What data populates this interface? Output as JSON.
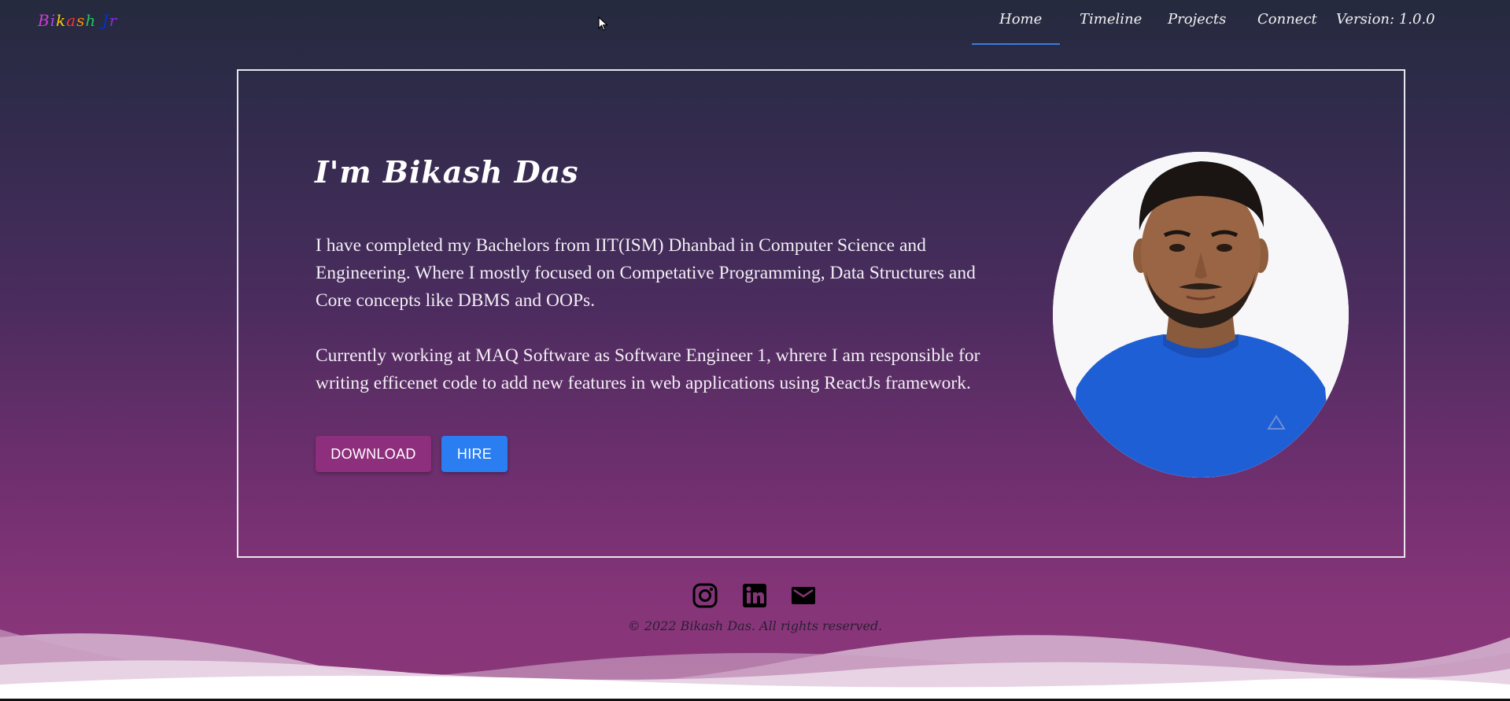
{
  "header": {
    "logo_text": "Bikash Jr",
    "logo_colors": [
      "#d23ad6",
      "#b040f0",
      "#ffcc00",
      "#ff3030",
      "#ff8a00",
      "#22c55e",
      "#1e90ff",
      "#0033cc",
      "#8a2be2"
    ],
    "nav": {
      "home": "Home",
      "timeline": "Timeline",
      "projects": "Projects",
      "connect": "Connect",
      "version": "Version: 1.0.0"
    },
    "active_color": "#3b7bd8"
  },
  "hero": {
    "title": "I'm Bikash Das",
    "paragraph_1": "I have completed my Bachelors from IIT(ISM) Dhanbad in Computer Science and Engineering. Where I mostly focused on Competative Programming, Data Structures and Core concepts like DBMS and OOPs.",
    "paragraph_2": "Currently working at MAQ Software as Software Engineer 1, whrere I am responsible for writing efficenet code to add new features in web applications using ReactJs framework.",
    "download_label": "DOWNLOAD",
    "hire_label": "HIRE",
    "download_color": "#8e2f7d",
    "hire_color": "#2a7ef2"
  },
  "profile_photo": {
    "shirt_color": "#1f5fd6",
    "background_color": "#f7f7f9"
  },
  "footer": {
    "social": [
      "instagram-icon",
      "linkedin-icon",
      "mail-icon"
    ],
    "copyright": "© 2022 Bikash Das. All rights reserved."
  }
}
